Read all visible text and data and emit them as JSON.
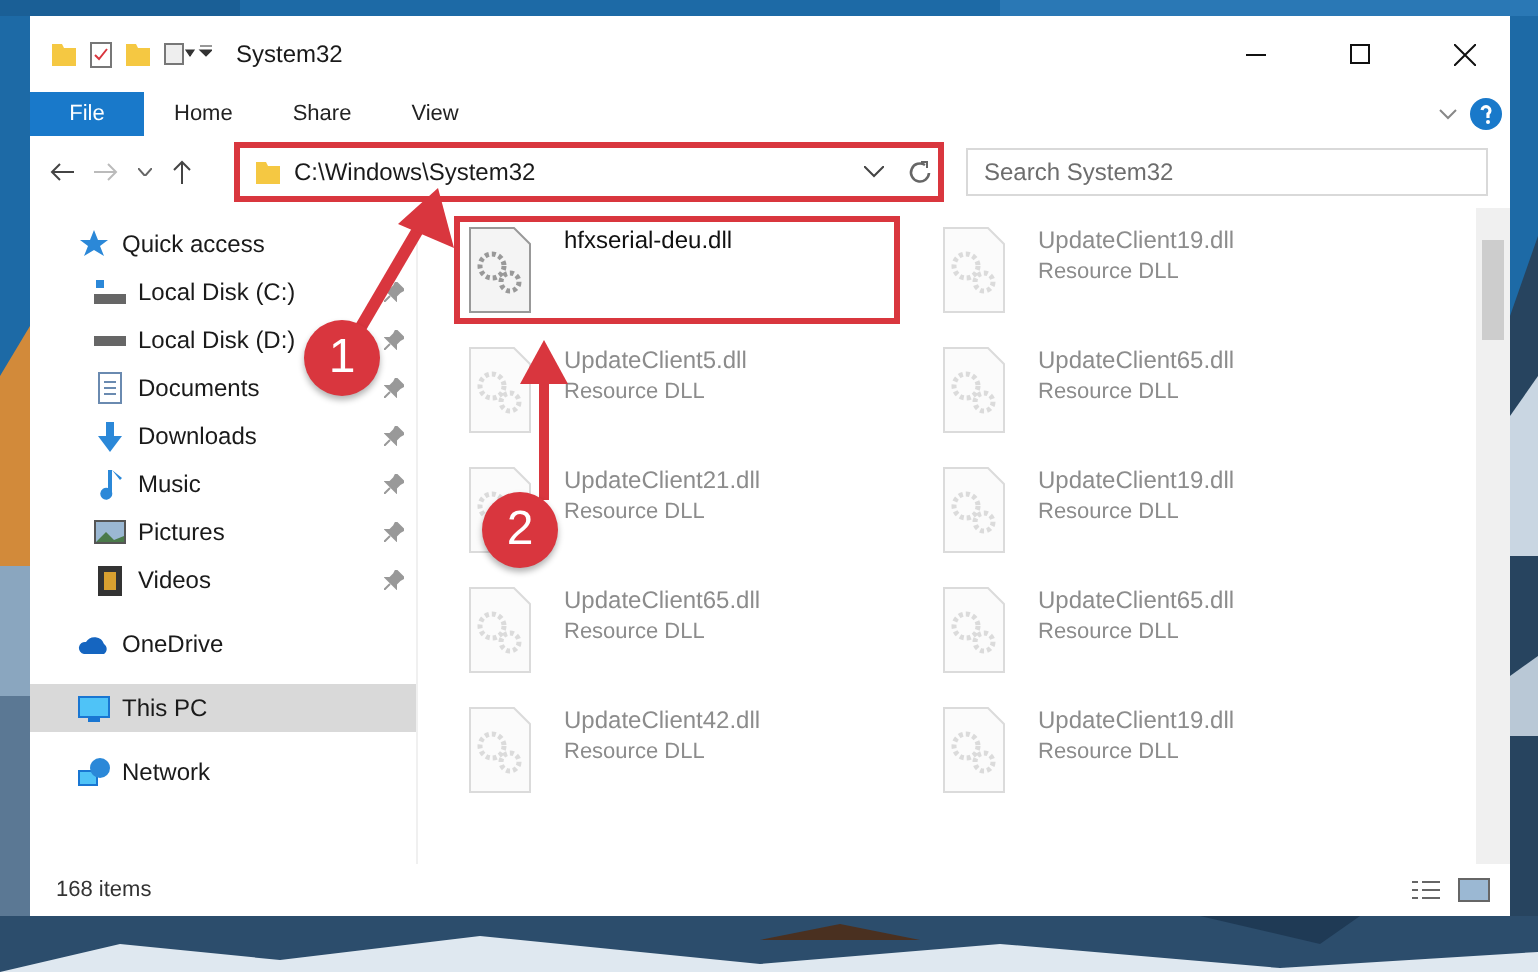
{
  "window": {
    "title": "System32"
  },
  "ribbon_tabs": [
    {
      "label": "File",
      "selected": true
    },
    {
      "label": "Home",
      "selected": false
    },
    {
      "label": "Share",
      "selected": false
    },
    {
      "label": "View",
      "selected": false
    }
  ],
  "address": {
    "path": "C:\\Windows\\System32"
  },
  "search": {
    "placeholder": "Search System32"
  },
  "sidebar": {
    "items": [
      {
        "label": "Quick access",
        "kind": "star",
        "selected": false,
        "children": [
          {
            "label": "Local Disk (C:)",
            "kind": "disk-c",
            "pinned": true,
            "selected": false
          },
          {
            "label": "Local Disk (D:)",
            "kind": "disk",
            "pinned": true,
            "selected": false
          },
          {
            "label": "Documents",
            "kind": "document",
            "pinned": true,
            "selected": false
          },
          {
            "label": "Downloads",
            "kind": "download",
            "pinned": true,
            "selected": false
          },
          {
            "label": "Music",
            "kind": "music",
            "pinned": true,
            "selected": false
          },
          {
            "label": "Pictures",
            "kind": "pictures",
            "pinned": true,
            "selected": false
          },
          {
            "label": "Videos",
            "kind": "videos",
            "pinned": true,
            "selected": false
          }
        ]
      },
      {
        "label": "OneDrive",
        "kind": "cloud",
        "selected": false
      },
      {
        "label": "This PC",
        "kind": "pc",
        "selected": true
      },
      {
        "label": "Network",
        "kind": "network",
        "selected": false
      }
    ]
  },
  "files": [
    {
      "name": "hfxserial-deu.dll",
      "faded": false
    },
    {
      "name": "UpdateClient19.dll",
      "type": "Resource DLL",
      "faded": true
    },
    {
      "name": "UpdateClient5.dll",
      "type": "Resource DLL",
      "faded": true
    },
    {
      "name": "UpdateClient65.dll",
      "type": "Resource DLL",
      "faded": true
    },
    {
      "name": "UpdateClient21.dll",
      "type": "Resource DLL",
      "faded": true
    },
    {
      "name": "UpdateClient19.dll",
      "type": "Resource DLL",
      "faded": true
    },
    {
      "name": "UpdateClient65.dll",
      "type": "Resource DLL",
      "faded": true
    },
    {
      "name": "UpdateClient65.dll",
      "type": "Resource DLL",
      "faded": true
    },
    {
      "name": "UpdateClient42.dll",
      "type": "Resource DLL",
      "faded": true
    },
    {
      "name": "UpdateClient19.dll",
      "type": "Resource DLL",
      "faded": true
    }
  ],
  "status_bar": {
    "count": "168 items"
  },
  "annotations": [
    {
      "number": "1"
    },
    {
      "number": "2"
    }
  ]
}
